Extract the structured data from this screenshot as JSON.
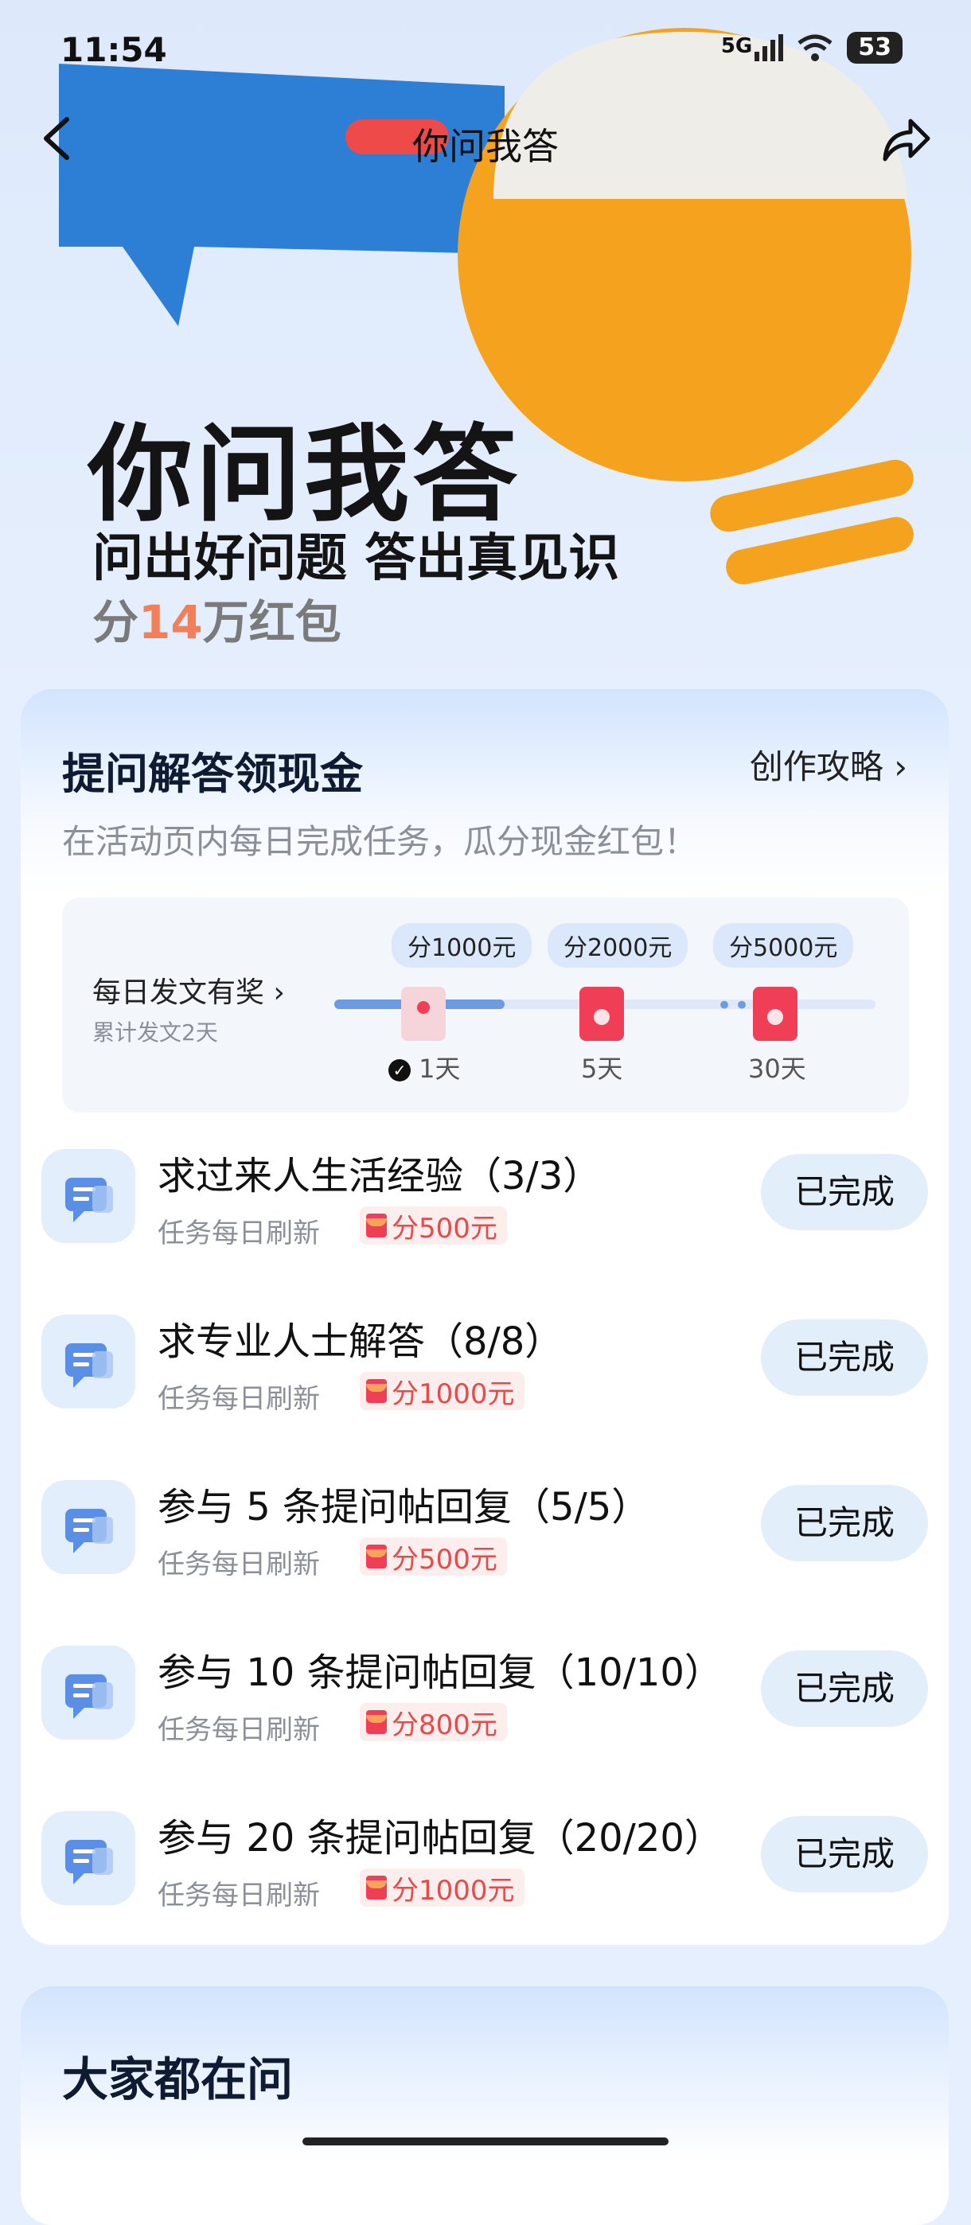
{
  "status_bar": {
    "time": "11:54",
    "network": "5G",
    "battery": "53"
  },
  "nav": {
    "title": "你问我答"
  },
  "hero": {
    "title": "你问我答",
    "subtitle": "问出好问题 答出真见识",
    "prize_prefix": "分",
    "prize_number": "14",
    "prize_suffix": "万红包"
  },
  "tasks_card": {
    "title": "提问解答领现金",
    "guide_label": "创作攻略",
    "description": "在活动页内每日完成任务，瓜分现金红包！",
    "daily": {
      "title": "每日发文有奖",
      "subtitle": "累计发文2天",
      "milestones": [
        {
          "reward": "分1000元",
          "day_label": "1天",
          "done": true
        },
        {
          "reward": "分2000元",
          "day_label": "5天",
          "done": false
        },
        {
          "reward": "分5000元",
          "day_label": "30天",
          "done": false
        }
      ]
    },
    "tasks": [
      {
        "name": "求过来人生活经验（3/3）",
        "refresh": "任务每日刷新",
        "reward": "分500元",
        "button": "已完成"
      },
      {
        "name": "求专业人士解答（8/8）",
        "refresh": "任务每日刷新",
        "reward": "分1000元",
        "button": "已完成"
      },
      {
        "name": "参与 5 条提问帖回复（5/5）",
        "refresh": "任务每日刷新",
        "reward": "分500元",
        "button": "已完成"
      },
      {
        "name": "参与 10 条提问帖回复（10/10）",
        "refresh": "任务每日刷新",
        "reward": "分800元",
        "button": "已完成"
      },
      {
        "name": "参与 20 条提问帖回复（20/20）",
        "refresh": "任务每日刷新",
        "reward": "分1000元",
        "button": "已完成"
      }
    ]
  },
  "asking_card": {
    "title": "大家都在问"
  },
  "colors": {
    "accent_blue": "#6d9be0",
    "red_envelope": "#ef3e55",
    "reward_text": "#e84a4a",
    "bulb_orange": "#f5a21e",
    "bubble_blue": "#2d7fd6"
  },
  "icons": [
    "back-arrow-icon",
    "share-icon",
    "chevron-right-icon",
    "chat-bubble-icon",
    "check-circle-icon",
    "red-envelope-icon",
    "signal-icon",
    "wifi-icon"
  ]
}
